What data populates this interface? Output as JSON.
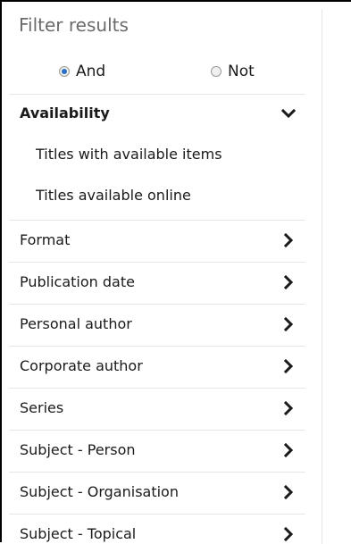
{
  "filter": {
    "title": "Filter results",
    "logic": {
      "and_label": "And",
      "not_label": "Not",
      "selected": "And"
    }
  },
  "availability": {
    "label": "Availability",
    "expanded": true,
    "items": [
      "Titles with available items",
      "Titles available online"
    ]
  },
  "facets": [
    {
      "label": "Format"
    },
    {
      "label": "Publication date"
    },
    {
      "label": "Personal author"
    },
    {
      "label": "Corporate author"
    },
    {
      "label": "Series"
    },
    {
      "label": "Subject - Person"
    },
    {
      "label": "Subject - Organisation"
    },
    {
      "label": "Subject - Topical"
    }
  ],
  "icons": {
    "expanded": "chevron-down-icon",
    "collapsed": "chevron-right-icon"
  },
  "colors": {
    "text": "#1a1a1a",
    "title": "#6b6b6b",
    "divider": "#e6e6e6",
    "radio_accent": "#2e6ecb"
  }
}
